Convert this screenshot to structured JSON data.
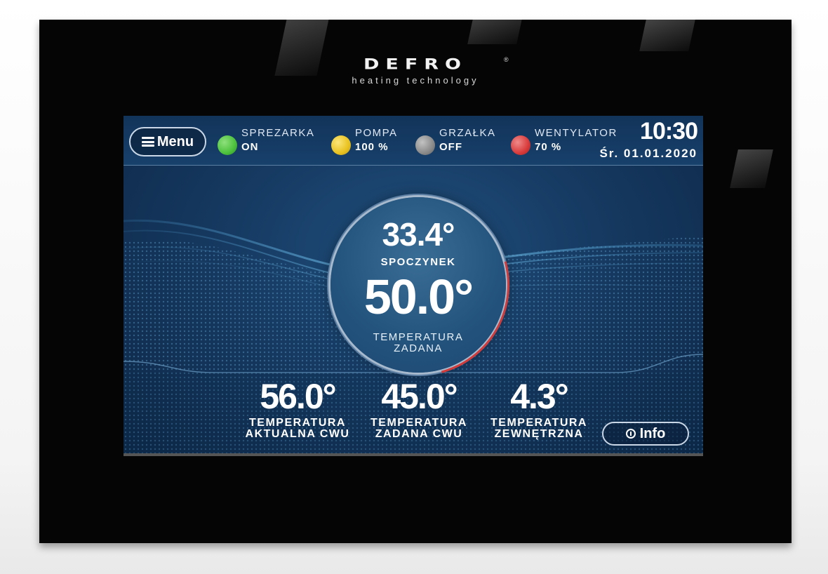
{
  "brand": {
    "logo": "DEFRO",
    "registered": "®",
    "tagline": "heating technology"
  },
  "topbar": {
    "menu_label": "Menu",
    "statuses": [
      {
        "name": "SPREZARKA",
        "value": "ON",
        "color": "#4cc13c"
      },
      {
        "name": "POMPA",
        "value": "100 %",
        "color": "#e9c21f"
      },
      {
        "name": "GRZAŁKA",
        "value": "OFF",
        "color": "#8a8a8a"
      },
      {
        "name": "WENTYLATOR",
        "value": "70 %",
        "color": "#d93a3a"
      }
    ],
    "time": "10:30",
    "date": "Śr. 01.01.2020"
  },
  "center": {
    "current_temp": "33.4°",
    "state": "SPOCZYNEK",
    "set_temp": "50.0°",
    "set_label_line1": "TEMPERATURA",
    "set_label_line2": "ZADANA"
  },
  "metrics": [
    {
      "value": "56.0°",
      "line1": "TEMPERATURA",
      "line2": "AKTUALNA CWU"
    },
    {
      "value": "45.0°",
      "line1": "TEMPERATURA",
      "line2": "ZADANA CWU"
    },
    {
      "value": "4.3°",
      "line1": "TEMPERATURA",
      "line2": "ZEWNĘTRZNA"
    }
  ],
  "info_label": "Info"
}
